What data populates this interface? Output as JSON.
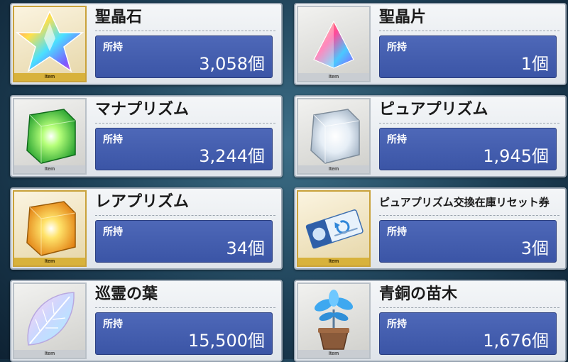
{
  "common": {
    "own_label": "所持",
    "item_tag": "Item"
  },
  "items": [
    {
      "name": "聖晶石",
      "count": "3,058個",
      "icon": "saint-quartz-icon"
    },
    {
      "name": "聖晶片",
      "count": "1個",
      "icon": "quartz-fragment-icon"
    },
    {
      "name": "マナプリズム",
      "count": "3,244個",
      "icon": "mana-prism-icon"
    },
    {
      "name": "ピュアプリズム",
      "count": "1,945個",
      "icon": "pure-prism-icon"
    },
    {
      "name": "レアプリズム",
      "count": "34個",
      "icon": "rare-prism-icon"
    },
    {
      "name": "ピュアプリズム交換在庫リセット券",
      "count": "3個",
      "icon": "reset-ticket-icon"
    },
    {
      "name": "巡霊の葉",
      "count": "15,500個",
      "icon": "spirit-leaf-icon"
    },
    {
      "name": "青銅の苗木",
      "count": "1,676個",
      "icon": "bronze-sapling-icon"
    }
  ]
}
